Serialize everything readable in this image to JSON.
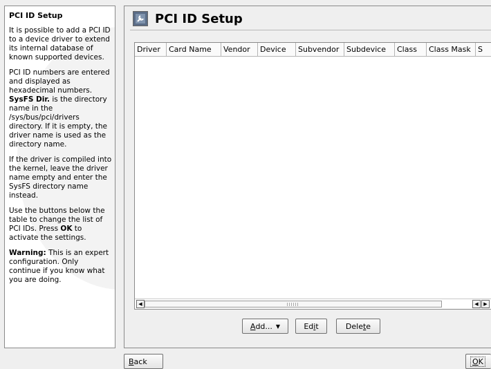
{
  "help": {
    "title": "PCI ID Setup",
    "p1": "It is possible to add a PCI ID to a device driver to extend its internal database of known supported devices.",
    "p2_pre": "PCI ID numbers are entered and displayed as hexadecimal numbers.",
    "p2_bold": "SysFS Dir.",
    "p2_post": " is the directory name in the /sys/bus/pci/drivers directory. If it is empty, the driver name is used as the directory name.",
    "p3": "If the driver is compiled into the kernel, leave the driver name empty and enter the SysFS directory name instead.",
    "p4_pre": "Use the buttons below the table to change the list of PCI IDs. Press ",
    "p4_bold": "OK",
    "p4_post": " to activate the settings.",
    "p5_bold": "Warning:",
    "p5_post": " This is an expert configuration. Only continue if you know what you are doing."
  },
  "main": {
    "title": "PCI ID Setup",
    "icon": "wrench-icon",
    "table": {
      "columns": [
        "Driver",
        "Card Name",
        "Vendor",
        "Device",
        "Subvendor",
        "Subdevice",
        "Class",
        "Class Mask",
        "S"
      ],
      "rows": []
    },
    "buttons": {
      "add_a": "A",
      "add_rest": "dd...",
      "edit_a": "Ed",
      "edit_u": "i",
      "edit_b": "t",
      "delete_a": "Dele",
      "delete_u": "t",
      "delete_b": "e"
    }
  },
  "footer": {
    "back_u": "B",
    "back_rest": "ack",
    "ok_u": "O",
    "ok_rest": "K"
  },
  "colors": {
    "title_icon": "#5a6c86"
  }
}
